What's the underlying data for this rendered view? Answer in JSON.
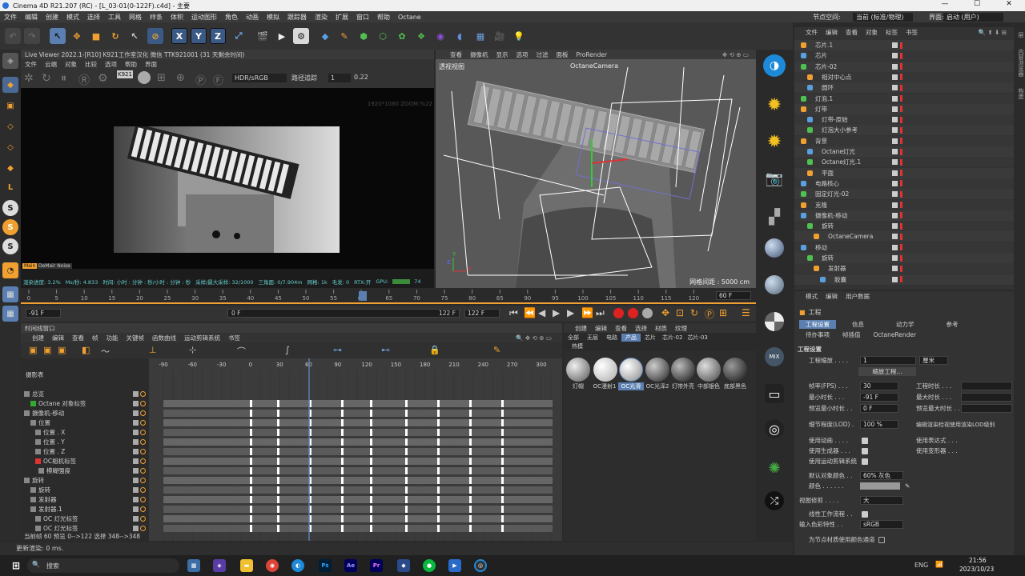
{
  "window": {
    "title": "Cinema 4D R21.207 (RC) - [L_03-01(0-122F).c4d] - 主要",
    "min": "—",
    "max": "☐",
    "close": "✕"
  },
  "menu": [
    "文件",
    "编辑",
    "创建",
    "模式",
    "选择",
    "工具",
    "网格",
    "样条",
    "体积",
    "运动图形",
    "角色",
    "动画",
    "模拟",
    "跟踪器",
    "渲染",
    "扩展",
    "窗口",
    "帮助",
    "Octane"
  ],
  "menu_right": {
    "node_space_label": "节点空间:",
    "node_space_value": "当前 (标准/物理)",
    "interface_label": "界面:",
    "interface_value": "启动 (用户)"
  },
  "toolbar_axes": [
    "X",
    "Y",
    "Z"
  ],
  "live_viewer": {
    "title": "Live Viewer 2022.1-[R10]  K921工作室汉化  微信  TTK921001 (31 天剩余时间)",
    "menu": [
      "文件",
      "云端",
      "对象",
      "比较",
      "选项",
      "帮助",
      "界面"
    ],
    "color_space": "HDR/sRGB",
    "mode": "路径追踪",
    "spin_value": "1",
    "value2": "0.22",
    "overlay": "1920*1080 ZOOM:%22",
    "noise_tag": "Main",
    "noise_label": "DeMair Noise",
    "status": [
      "渲染进度: 3.2%",
      "Ms/秒: 4.833",
      "时间: 小时 : 分钟 : 秒/小时 : 分钟 : 秒",
      "采样/最大采样: 32/1000",
      "三角面: 0/7.904m",
      "网格: 1k",
      "毛发: 0",
      "RTX:开",
      "GPU:",
      "74"
    ],
    "badge": "K921"
  },
  "viewport": {
    "menu": [
      "查看",
      "摄像机",
      "显示",
      "选项",
      "过滤",
      "面板",
      "ProRender"
    ],
    "label": "透视视图",
    "camera": "OctaneCamera",
    "grid_info": "网格间距 : 5000 cm",
    "axis_x": "X",
    "axis_y": "Y",
    "axis_z": "Z"
  },
  "timeline_ruler": {
    "ticks": [
      "0",
      "5",
      "10",
      "15",
      "20",
      "25",
      "30",
      "35",
      "40",
      "45",
      "50",
      "55",
      "60",
      "65",
      "70",
      "75",
      "80",
      "85",
      "90",
      "95",
      "100",
      "105",
      "110",
      "115",
      "120"
    ],
    "frame_field": "60 F"
  },
  "transport": {
    "start": "-91 F",
    "cur": "0 F",
    "end": "122 F",
    "end2": "122 F"
  },
  "timeline_window": {
    "title": "时间线窗口",
    "menu": [
      "创建",
      "编辑",
      "查看",
      "帧",
      "功能",
      "关键帧",
      "函数曲线",
      "运动剪辑系统",
      "书签"
    ],
    "dopesheet": "摄影表",
    "ticks": [
      "-90",
      "-60",
      "-30",
      "0",
      "30",
      "60",
      "90",
      "120",
      "150",
      "180",
      "210",
      "240",
      "270",
      "300"
    ],
    "tracks": [
      "总览",
      "Octane 对象标签",
      "摄像机-移动",
      "位置",
      "位置 . X",
      "位置 . Y",
      "位置 . Z",
      "OC相机标签",
      "模糊强度",
      "旋转",
      "旋转",
      "发射器",
      "发射器.1",
      "OC 灯光标签",
      "OC 灯光标签"
    ],
    "footer": "当前帧  60  预览  0-->122  选择 348-->348"
  },
  "status_bar": "更新渲染: 0 ms.",
  "materials": {
    "menu": [
      "创建",
      "编辑",
      "查看",
      "选择",
      "材质",
      "纹理"
    ],
    "tabs": [
      "全部",
      "无层",
      "电路",
      "产品",
      "芯片",
      "芯片-02",
      "芯片-03"
    ],
    "subtab": "热模",
    "items": [
      "灯帽",
      "OC漫射1",
      "OC光滑",
      "OC光泽2",
      "灯带外亮",
      "中部银色",
      "底部黑色"
    ]
  },
  "object_manager": {
    "menu": [
      "文件",
      "编辑",
      "查看",
      "对象",
      "标签",
      "书签"
    ],
    "side_labels": [
      "层",
      "内容浏览器",
      "构造"
    ],
    "objects": [
      "芯片.1",
      "芯片",
      "芯片-02",
      "相对中心点",
      "圆环",
      "灯泡.1",
      "灯带",
      "灯带-原始",
      "灯泡大小参考",
      "背景",
      "Octane灯光",
      "Octane灯光.1",
      "平面",
      "电路核心",
      "固定灯光-02",
      "克隆",
      "摄像机-移动",
      "旋转",
      "OctaneCamera",
      "移动",
      "旋转",
      "发射器",
      "胶囊"
    ]
  },
  "attributes": {
    "menu": [
      "模式",
      "编辑",
      "用户数据"
    ],
    "title": "工程",
    "tabs": [
      "工程设置",
      "信息",
      "动力学",
      "参考"
    ],
    "tabs2": [
      "待办事项",
      "帧插值",
      "OctaneRender"
    ],
    "section": "工程设置",
    "scale_label": "工程缩放 . . . .",
    "scale_value": "1",
    "scale_unit": "厘米",
    "scale_btn": "缩放工程...",
    "fps_label": "帧率(FPS) . . .",
    "fps_value": "30",
    "project_time_label": "工程时长 . . .",
    "min_time_label": "最小时长 . . .",
    "min_time_value": "-91 F",
    "max_time_label": "最大时长 . . .",
    "preview_min_label": "预览最小时长 . .",
    "preview_min_value": "0 F",
    "preview_max_label": "预览最大时长 . .",
    "lod_label": "细节程度(LOD) .",
    "lod_value": "100 %",
    "lod_render_label": "编辑渲染检视使用渲染LOD级别",
    "use_anim": "使用动画 . . . .",
    "use_expr": "使用表达式 . . .",
    "use_gen": "使用生成器 . . .",
    "use_deform": "使用变形器 . . .",
    "use_motion": "使用运动剪辑系统",
    "default_color_label": "默认对象颜色 . .",
    "default_color_value": "60% 灰色",
    "color_label": "颜色 . . . . . .",
    "view_clip_label": "视图修剪 . . . .",
    "view_clip_value": "大",
    "linear_label": "线性工作流程 . .",
    "input_color_label": "输入色彩特性 . .",
    "input_color_value": "sRGB",
    "node_color_label": "为节点材质使用颜色通道"
  },
  "taskbar": {
    "search": "搜索",
    "lang": "ENG",
    "time": "21:56",
    "date": "2023/10/23",
    "apps": [
      "Ps",
      "Ae",
      "Pr"
    ]
  }
}
